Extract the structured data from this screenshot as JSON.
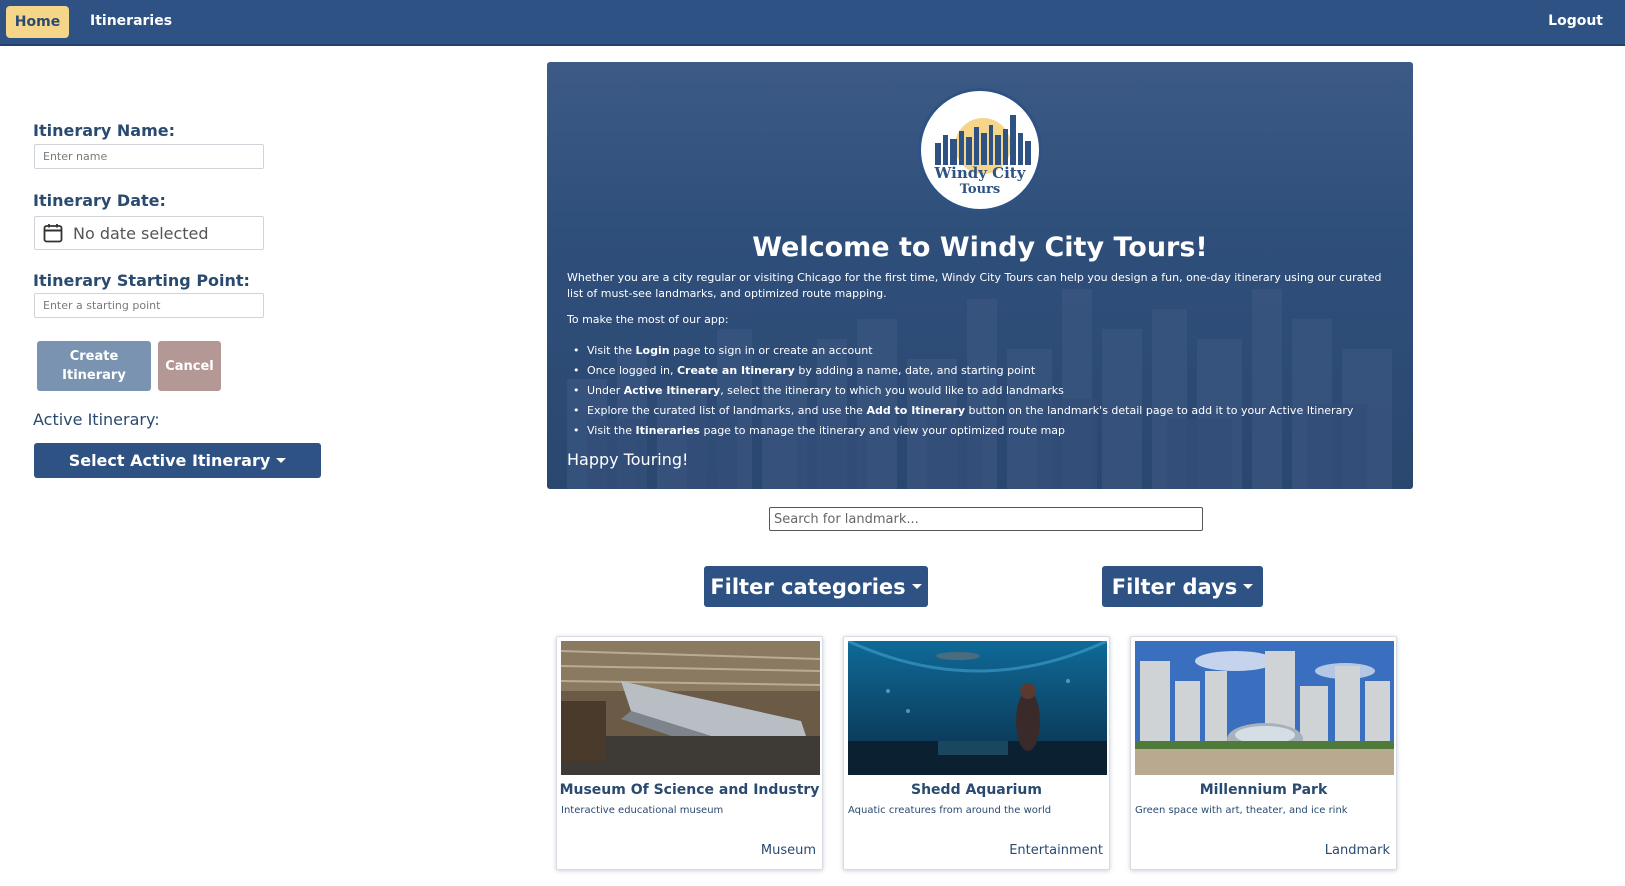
{
  "nav": {
    "home": "Home",
    "itineraries": "Itineraries",
    "logout": "Logout"
  },
  "form": {
    "name_label": "Itinerary Name:",
    "name_placeholder": "Enter name",
    "date_label": "Itinerary Date:",
    "date_value": "No date selected",
    "start_label": "Itinerary Starting Point:",
    "start_placeholder": "Enter a starting point",
    "create_line1": "Create",
    "create_line2": "Itinerary",
    "cancel": "Cancel",
    "active_label": "Active Itinerary:",
    "select_active": "Select Active Itinerary"
  },
  "hero": {
    "logo_line1": "Windy City",
    "logo_line2": "Tours",
    "title": "Welcome to Windy City Tours!",
    "intro": "Whether you are a city regular or visiting Chicago for the first time, Windy City Tours can help you design a fun, one-day itinerary using our curated list of must-see landmarks, and optimized route mapping.",
    "make_most": "To make the most of our app:",
    "steps": [
      {
        "pre": "Visit the ",
        "bold": "Login",
        "post": " page to sign in or create an account"
      },
      {
        "pre": "Once logged in, ",
        "bold": "Create an Itinerary",
        "post": " by adding a name, date, and starting point"
      },
      {
        "pre": "Under ",
        "bold": "Active Itinerary",
        "post": ", select the itinerary to which you would like to add landmarks"
      },
      {
        "pre": "Explore the curated list of landmarks, and use the ",
        "bold": "Add to Itinerary",
        "post": " button on the landmark's detail page to add it to your Active Itinerary"
      },
      {
        "pre": "Visit the ",
        "bold": "Itineraries",
        "post": " page to manage the itinerary and view your optimized route map"
      }
    ],
    "happy": "Happy Touring!"
  },
  "search": {
    "placeholder": "Search for landmark..."
  },
  "filters": {
    "categories": "Filter categories",
    "days": "Filter days"
  },
  "cards": [
    {
      "title": "Museum Of Science and Industry",
      "desc": "Interactive educational museum",
      "category": "Museum"
    },
    {
      "title": "Shedd Aquarium",
      "desc": "Aquatic creatures from around the world",
      "category": "Entertainment"
    },
    {
      "title": "Millennium Park",
      "desc": "Green space with art, theater, and ice rink",
      "category": "Landmark"
    }
  ],
  "colors": {
    "primary": "#2d5283",
    "accent": "#f5d58a",
    "create_btn": "#7a93b1",
    "cancel_btn": "#b39896"
  }
}
